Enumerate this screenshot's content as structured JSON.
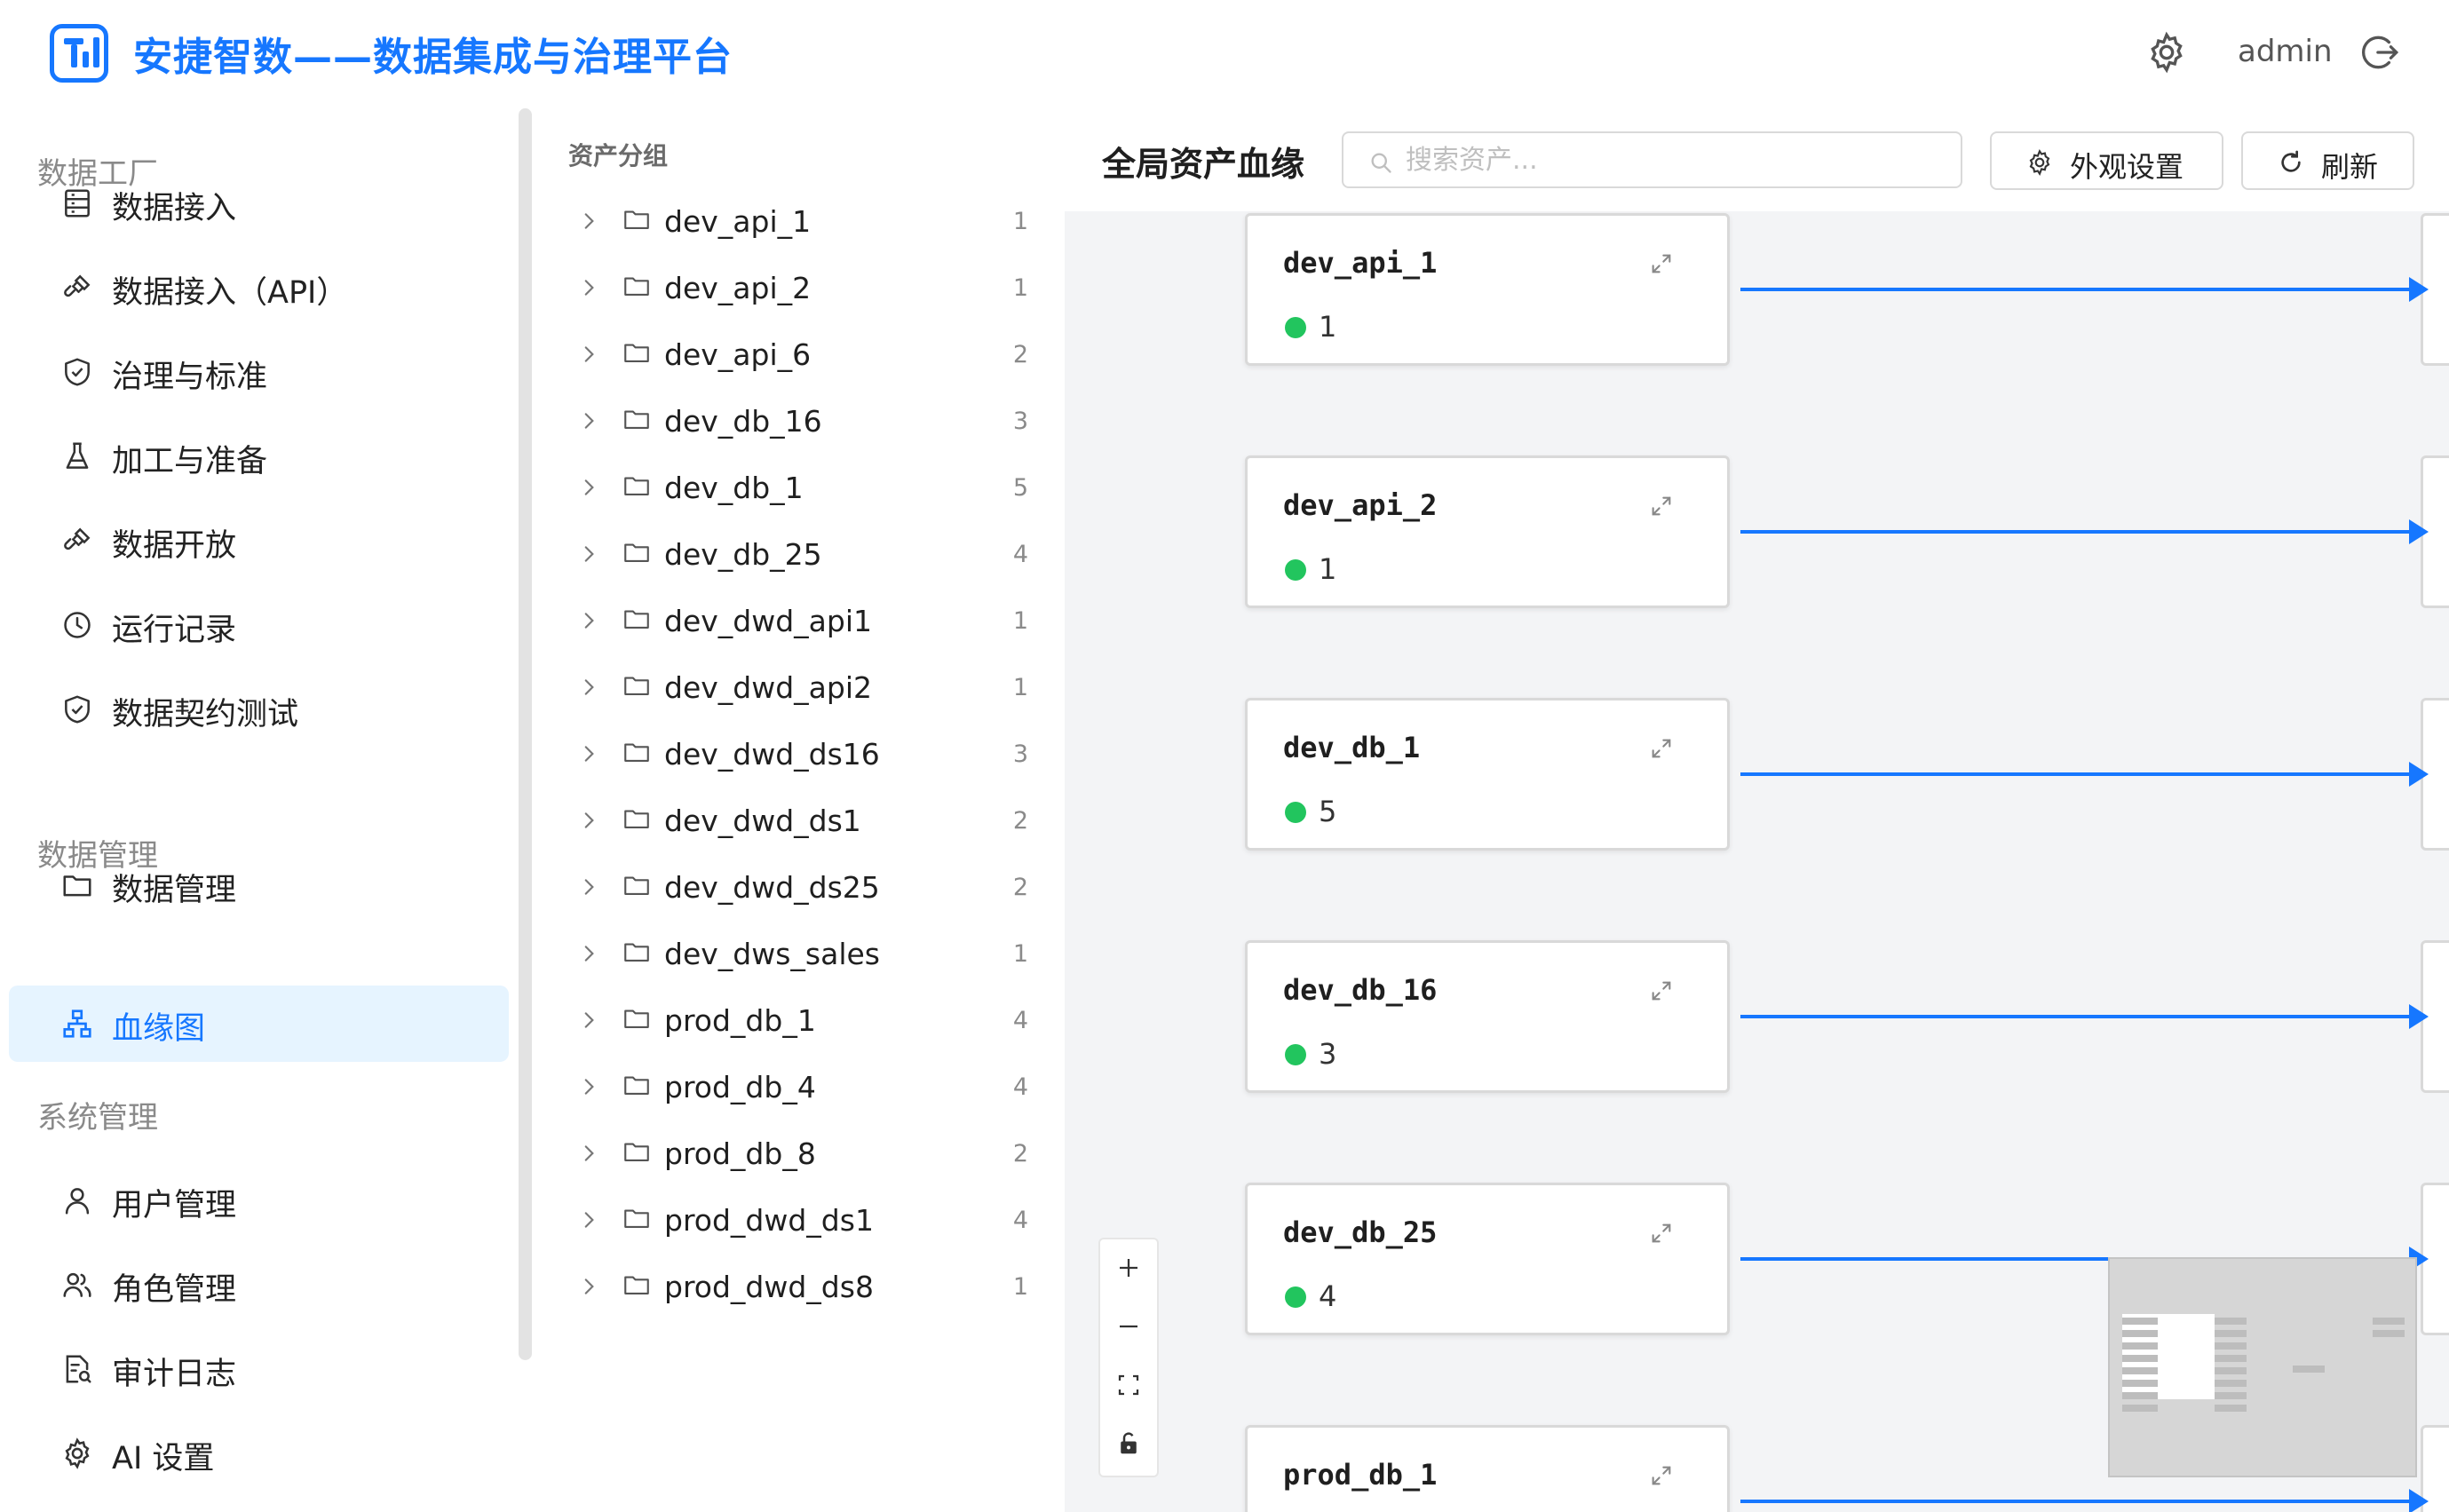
{
  "header": {
    "app_title": "安捷智数——数据集成与治理平台",
    "username": "admin",
    "icons": [
      "settings-icon",
      "logout-icon"
    ]
  },
  "sidebar": {
    "groups": [
      {
        "title": "数据工厂",
        "items": [
          {
            "label": "数据接入",
            "icon": "database-list-icon"
          },
          {
            "label": "数据接入（API）",
            "icon": "api-plug-icon"
          },
          {
            "label": "治理与标准",
            "icon": "shield-check-icon"
          },
          {
            "label": "加工与准备",
            "icon": "flask-icon"
          },
          {
            "label": "数据开放",
            "icon": "api-plug-icon"
          },
          {
            "label": "运行记录",
            "icon": "clock-icon"
          },
          {
            "label": "数据契约测试",
            "icon": "shield-check-icon"
          }
        ]
      },
      {
        "title": "数据管理",
        "items": [
          {
            "label": "数据管理",
            "icon": "folder-icon"
          },
          {
            "label": "血缘图",
            "icon": "lineage-tree-icon",
            "active": true
          }
        ]
      },
      {
        "title": "系统管理",
        "items": [
          {
            "label": "用户管理",
            "icon": "user-icon"
          },
          {
            "label": "角色管理",
            "icon": "team-icon"
          },
          {
            "label": "审计日志",
            "icon": "audit-doc-icon"
          },
          {
            "label": "AI 设置",
            "icon": "gear-icon"
          }
        ]
      }
    ]
  },
  "asset_tree": {
    "title": "资产分组",
    "items": [
      {
        "name": "dev_api_1",
        "count": "1"
      },
      {
        "name": "dev_api_2",
        "count": "1"
      },
      {
        "name": "dev_api_6",
        "count": "2"
      },
      {
        "name": "dev_db_16",
        "count": "3"
      },
      {
        "name": "dev_db_1",
        "count": "5"
      },
      {
        "name": "dev_db_25",
        "count": "4"
      },
      {
        "name": "dev_dwd_api1",
        "count": "1"
      },
      {
        "name": "dev_dwd_api2",
        "count": "1"
      },
      {
        "name": "dev_dwd_ds16",
        "count": "3"
      },
      {
        "name": "dev_dwd_ds1",
        "count": "2"
      },
      {
        "name": "dev_dwd_ds25",
        "count": "2"
      },
      {
        "name": "dev_dws_sales",
        "count": "1"
      },
      {
        "name": "prod_db_1",
        "count": "4"
      },
      {
        "name": "prod_db_4",
        "count": "4"
      },
      {
        "name": "prod_db_8",
        "count": "2"
      },
      {
        "name": "prod_dwd_ds1",
        "count": "4"
      },
      {
        "name": "prod_dwd_ds8",
        "count": "1"
      }
    ]
  },
  "lineage": {
    "title": "全局资产血缘",
    "search_placeholder": "搜索资产...",
    "appearance_button": "外观设置",
    "refresh_button": "刷新",
    "nodes": [
      {
        "name": "dev_api_1",
        "count": "1"
      },
      {
        "name": "dev_api_2",
        "count": "1"
      },
      {
        "name": "dev_db_1",
        "count": "5"
      },
      {
        "name": "dev_db_16",
        "count": "3"
      },
      {
        "name": "dev_db_25",
        "count": "4"
      },
      {
        "name": "prod_db_1",
        "count": ""
      }
    ],
    "status_color": "#22c55e",
    "edge_color": "#1677ff",
    "zoom_controls": [
      "zoom-in-icon",
      "zoom-out-icon",
      "fit-view-icon",
      "lock-icon"
    ]
  },
  "colors": {
    "accent": "#1677ff",
    "active_bg": "#e6f4ff",
    "canvas_bg": "#f3f4f6"
  }
}
